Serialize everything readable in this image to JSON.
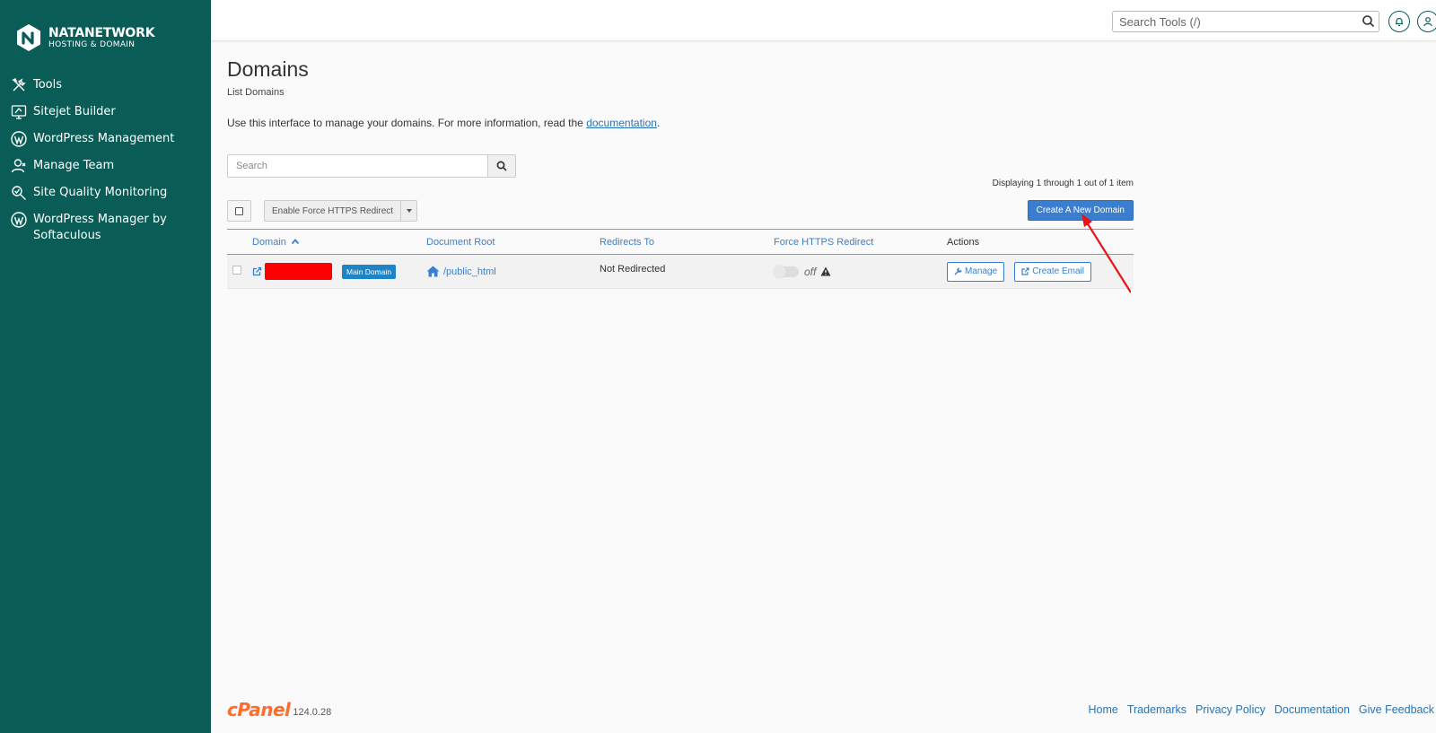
{
  "brand": {
    "name": "NATANETWORK",
    "tagline": "HOSTING & DOMAIN"
  },
  "sidebar": {
    "items": [
      {
        "label": "Tools",
        "icon": "tools-icon"
      },
      {
        "label": "Sitejet Builder",
        "icon": "sitejet-icon"
      },
      {
        "label": "WordPress Management",
        "icon": "wordpress-icon"
      },
      {
        "label": "Manage Team",
        "icon": "team-icon"
      },
      {
        "label": "Site Quality Monitoring",
        "icon": "monitoring-icon"
      },
      {
        "label": "WordPress Manager by Softaculous",
        "icon": "wordpress-icon"
      }
    ]
  },
  "topbar": {
    "search_placeholder": "Search Tools (/)"
  },
  "page": {
    "title": "Domains",
    "subtitle": "List Domains",
    "intro_text": "Use this interface to manage your domains. For more information, read the ",
    "intro_link": "documentation",
    "intro_end": ".",
    "search_placeholder": "Search",
    "display_count": "Displaying 1 through 1 out of 1 item",
    "bulk_action": "Enable Force HTTPS Redirect",
    "create_button": "Create A New Domain"
  },
  "table": {
    "columns": [
      "Domain",
      "Document Root",
      "Redirects To",
      "Force HTTPS Redirect",
      "Actions"
    ],
    "rows": [
      {
        "badge": "Main Domain",
        "document_root": "/public_html",
        "redirects_to": "Not Redirected",
        "https_status": "off",
        "manage_label": "Manage",
        "email_label": "Create Email"
      }
    ]
  },
  "footer": {
    "brand": "cPanel",
    "version": "124.0.28",
    "links": [
      "Home",
      "Trademarks",
      "Privacy Policy",
      "Documentation",
      "Give Feedback"
    ]
  },
  "colors": {
    "sidebar": "#0a5c56",
    "accent": "#3a7fcf",
    "badge": "#1f84c6",
    "cpanel": "#ff6c2c",
    "redact": "#ff0000"
  }
}
